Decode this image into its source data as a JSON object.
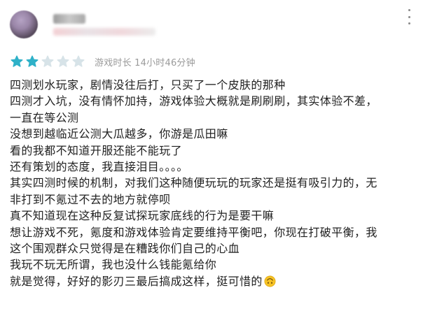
{
  "colors": {
    "star_active": "#2fb1c8",
    "star_inactive": "#d7e3e8",
    "meta_text": "#9a9a9a",
    "body_text": "#1f1f1f"
  },
  "review": {
    "rating": 2,
    "rating_max": 5,
    "playtime": "游戏时长 14小时46分钟",
    "lines": [
      "四测划水玩家，剧情没往后打，只买了一个皮肤的那种",
      "四测才入坑，没有情怀加持，游戏体验大概就是刷刷刷，其实体验不差，",
      "一直在等公测",
      "没想到越临近公测大瓜越多，你游是瓜田嘛",
      "看的我都不知道开服还能不能玩了",
      "还有策划的态度，我直接泪目。。。。",
      "其实四测时候的机制，对我们这种随便玩玩的玩家还是挺有吸引力的，无",
      "非打到不氪过不去的地方就停呗",
      "真不知道现在这种反复试探玩家底线的行为是要干嘛",
      "想让游戏不死，氪度和游戏体验肯定要维持平衡吧，你现在打破平衡，我",
      "这个围观群众只觉得是在糟践你们自己的心血",
      "我玩不玩无所谓，我也没什么钱能氪给你"
    ],
    "last_line": "就是觉得，好好的影刃三最后搞成这样，挺可惜的",
    "last_line_icon": "upside-down-face-emoji"
  }
}
